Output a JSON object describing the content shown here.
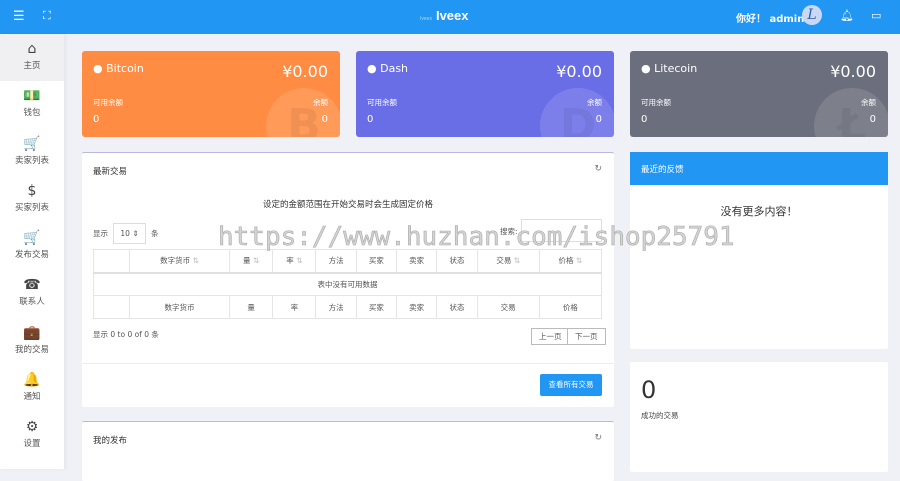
{
  "topbar": {
    "menu_icon": "menu-icon",
    "fullscreen_icon": "fullscreen-icon",
    "brand_small": "Iveex",
    "brand": "Iveex",
    "greeting": "你好！",
    "username": "admin",
    "avatar_letter": "L"
  },
  "sidebar": [
    {
      "label": "主页",
      "icon": "⌂"
    },
    {
      "label": "钱包",
      "icon": "💵"
    },
    {
      "label": "卖家列表",
      "icon": "🛒"
    },
    {
      "label": "买家列表",
      "icon": "$"
    },
    {
      "label": "发布交易",
      "icon": "🛒"
    },
    {
      "label": "联系人",
      "icon": "☎"
    },
    {
      "label": "我的交易",
      "icon": "💼"
    },
    {
      "label": "通知",
      "icon": "🔔"
    },
    {
      "label": "设置",
      "icon": "⚙"
    }
  ],
  "wallets": [
    {
      "name": "Bitcoin",
      "amount": "¥0.00",
      "available_label": "可用余额",
      "available": "0",
      "balance_label": "余额",
      "balance": "0",
      "color": "#ff8c42",
      "symbol": "B"
    },
    {
      "name": "Dash",
      "amount": "¥0.00",
      "available_label": "可用余额",
      "available": "0",
      "balance_label": "余额",
      "balance": "0",
      "color": "#6a6ee6",
      "symbol": "D"
    },
    {
      "name": "Litecoin",
      "amount": "¥0.00",
      "available_label": "可用余额",
      "available": "0",
      "balance_label": "余额",
      "balance": "0",
      "color": "#6b6e7c",
      "symbol": "Ł"
    }
  ],
  "latest": {
    "title": "最新交易",
    "note": "设定的金额范围在开始交易时会生成固定价格",
    "show": "显示",
    "page_size": "10",
    "entries": "条",
    "search_label": "搜索:",
    "columns": [
      "",
      "数字货币",
      "量",
      "率",
      "方法",
      "买家",
      "卖家",
      "状态",
      "交易",
      "价格"
    ],
    "empty": "表中没有可用数据",
    "info": "显示 0 to 0 of 0 条",
    "prev": "上一页",
    "next": "下一页",
    "view_all": "查看所有交易"
  },
  "feedback": {
    "title": "最近的反馈",
    "empty": "没有更多内容！"
  },
  "stats": {
    "count": "0",
    "label": "成功的交易"
  },
  "my_posts": {
    "title": "我的发布"
  },
  "watermark": "https://www.huzhan.com/ishop25791"
}
